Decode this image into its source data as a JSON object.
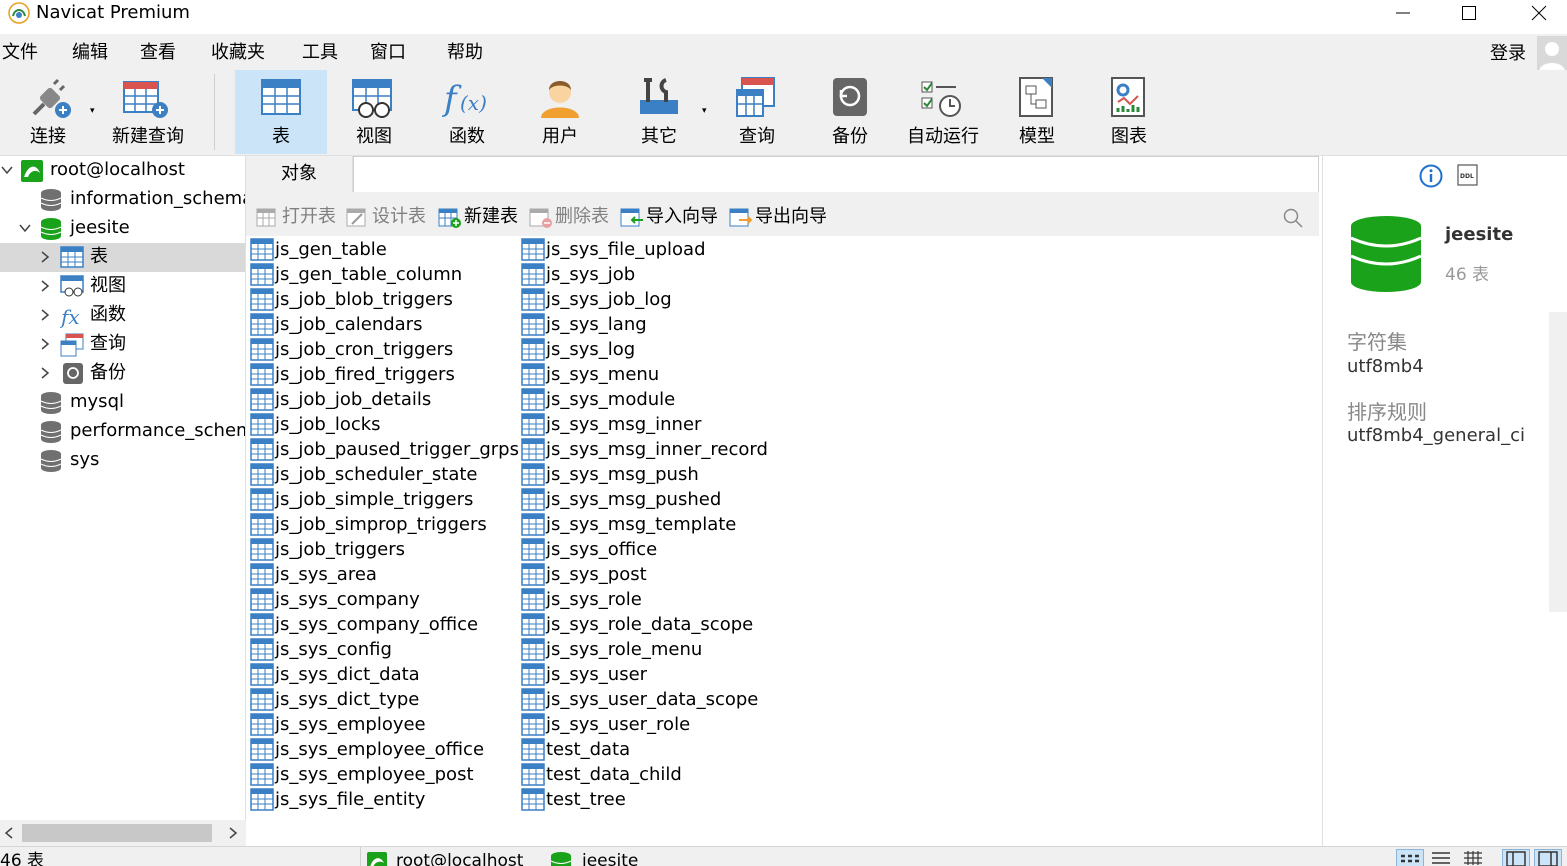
{
  "window": {
    "title": "Navicat Premium"
  },
  "menu": {
    "items": [
      "文件",
      "编辑",
      "查看",
      "收藏夹",
      "工具",
      "窗口",
      "帮助"
    ],
    "login": "登录"
  },
  "toolbar": {
    "items": [
      {
        "label": "连接",
        "icon": "connection-icon"
      },
      {
        "label": "新建查询",
        "icon": "new-query-icon"
      },
      {
        "label": "表",
        "icon": "table-icon",
        "active": true
      },
      {
        "label": "视图",
        "icon": "view-icon"
      },
      {
        "label": "函数",
        "icon": "function-icon"
      },
      {
        "label": "用户",
        "icon": "user-icon"
      },
      {
        "label": "其它",
        "icon": "tools-icon"
      },
      {
        "label": "查询",
        "icon": "query-icon"
      },
      {
        "label": "备份",
        "icon": "backup-icon"
      },
      {
        "label": "自动运行",
        "icon": "schedule-icon"
      },
      {
        "label": "模型",
        "icon": "model-icon"
      },
      {
        "label": "图表",
        "icon": "chart-icon"
      }
    ]
  },
  "sidebar": {
    "connection": "root@localhost",
    "databases": {
      "information_schema": "information_schema",
      "jeesite": "jeesite",
      "mysql": "mysql",
      "performance_schema": "performance_schema",
      "sys": "sys"
    },
    "nodes": {
      "tables": "表",
      "views": "视图",
      "functions": "函数",
      "queries": "查询",
      "backups": "备份"
    }
  },
  "tabs": {
    "objects": "对象"
  },
  "objtoolbar": {
    "open_table": "打开表",
    "design_table": "设计表",
    "new_table": "新建表",
    "delete_table": "删除表",
    "import_wizard": "导入向导",
    "export_wizard": "导出向导"
  },
  "tables_col1": [
    "js_gen_table",
    "js_gen_table_column",
    "js_job_blob_triggers",
    "js_job_calendars",
    "js_job_cron_triggers",
    "js_job_fired_triggers",
    "js_job_job_details",
    "js_job_locks",
    "js_job_paused_trigger_grps",
    "js_job_scheduler_state",
    "js_job_simple_triggers",
    "js_job_simprop_triggers",
    "js_job_triggers",
    "js_sys_area",
    "js_sys_company",
    "js_sys_company_office",
    "js_sys_config",
    "js_sys_dict_data",
    "js_sys_dict_type",
    "js_sys_employee",
    "js_sys_employee_office",
    "js_sys_employee_post",
    "js_sys_file_entity"
  ],
  "tables_col2": [
    "js_sys_file_upload",
    "js_sys_job",
    "js_sys_job_log",
    "js_sys_lang",
    "js_sys_log",
    "js_sys_menu",
    "js_sys_module",
    "js_sys_msg_inner",
    "js_sys_msg_inner_record",
    "js_sys_msg_push",
    "js_sys_msg_pushed",
    "js_sys_msg_template",
    "js_sys_office",
    "js_sys_post",
    "js_sys_role",
    "js_sys_role_data_scope",
    "js_sys_role_menu",
    "js_sys_user",
    "js_sys_user_data_scope",
    "js_sys_user_role",
    "test_data",
    "test_data_child",
    "test_tree"
  ],
  "info": {
    "db_name": "jeesite",
    "table_count": "46 表",
    "charset_label": "字符集",
    "charset_value": "utf8mb4",
    "collation_label": "排序规则",
    "collation_value": "utf8mb4_general_ci"
  },
  "status": {
    "count": "46 表",
    "connection": "root@localhost",
    "database": "jeesite"
  },
  "colors": {
    "db_green": "#1aa21a",
    "table_blue": "#3b7fc4",
    "active_bg": "#cce4f7"
  }
}
